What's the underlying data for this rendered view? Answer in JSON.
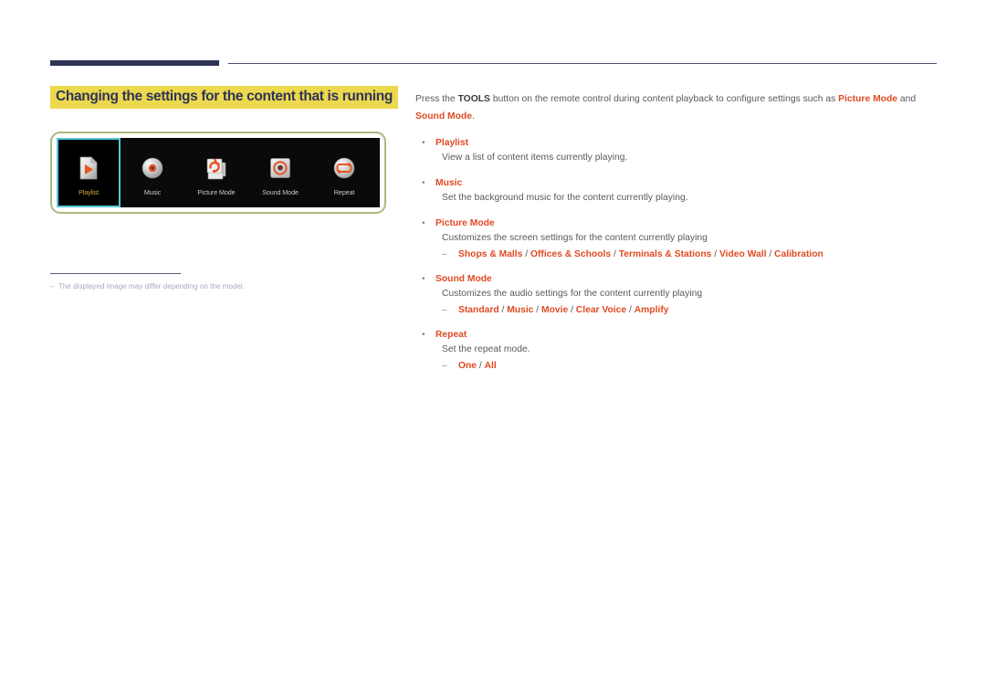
{
  "header": {
    "rule_thick_color": "#2f3356",
    "rule_thin_color": "#4b4f73"
  },
  "left": {
    "section_title": "Changing the settings for the content that is running",
    "highlight_color": "#ecd94e",
    "title_color": "#2f3356",
    "osd": {
      "selected_index": 0,
      "selection_color": "#55c9d6",
      "selected_label_color": "#d8a43c",
      "frame_color": "#a8b97f",
      "items": [
        {
          "label": "Playlist",
          "icon": "playlist-icon"
        },
        {
          "label": "Music",
          "icon": "music-disc-icon"
        },
        {
          "label": "Picture Mode",
          "icon": "picture-mode-icon"
        },
        {
          "label": "Sound Mode",
          "icon": "sound-mode-icon"
        },
        {
          "label": "Repeat",
          "icon": "repeat-icon"
        }
      ]
    },
    "note": {
      "dash": "–",
      "text": "The displayed image may differ depending on the model."
    }
  },
  "right": {
    "intro": {
      "part1": "Press the ",
      "tools": "TOOLS",
      "part2": " button on the remote control during content playback to configure settings such as ",
      "picture_mode": "Picture Mode",
      "part3": " and ",
      "sound_mode": "Sound Mode",
      "part4": "."
    },
    "bullet": "•",
    "subdash": "–",
    "accent_color": "#e04a23",
    "items": [
      {
        "title": "Playlist",
        "desc": "View a list of content items currently playing.",
        "options": null
      },
      {
        "title": "Music",
        "desc": "Set the background music for the content currently playing.",
        "options": null
      },
      {
        "title": "Picture Mode",
        "desc": "Customizes the screen settings for the content currently playing",
        "options": [
          "Shops & Malls",
          "Offices & Schools",
          "Terminals & Stations",
          "Video Wall",
          "Calibration"
        ]
      },
      {
        "title": "Sound Mode",
        "desc": "Customizes the audio settings for the content currently playing",
        "options": [
          "Standard",
          "Music",
          "Movie",
          "Clear Voice",
          "Amplify"
        ]
      },
      {
        "title": "Repeat",
        "desc": "Set the repeat mode.",
        "options": [
          "One",
          "All"
        ]
      }
    ]
  }
}
